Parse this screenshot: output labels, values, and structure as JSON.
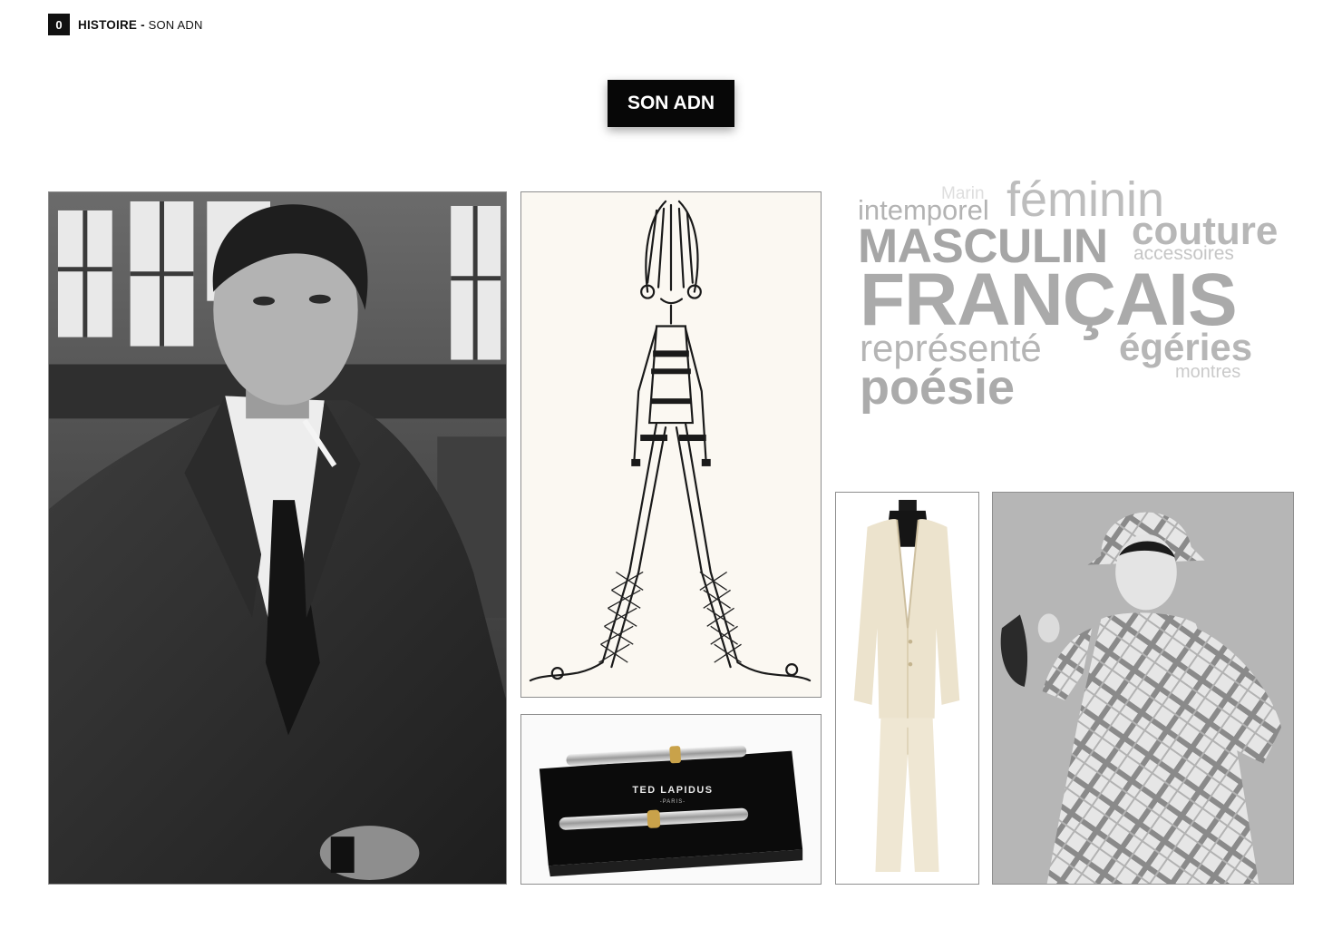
{
  "breadcrumb": {
    "number": "0",
    "section": "HISTOIRE",
    "separator": "-",
    "page": "SON ADN"
  },
  "title": "SON ADN",
  "pens_box": {
    "brand": "TED LAPIDUS",
    "city": "-PARIS-"
  },
  "word_cloud": {
    "marin": "Marin",
    "feminin": "féminin",
    "intemporel": "intemporel",
    "masculin": "MASCULIN",
    "couture": "couture",
    "accessoires": "accessoires",
    "francais": "FRANÇAIS",
    "represente": "représenté",
    "egeries": "égéries",
    "montres": "montres",
    "poesie": "poésie"
  }
}
